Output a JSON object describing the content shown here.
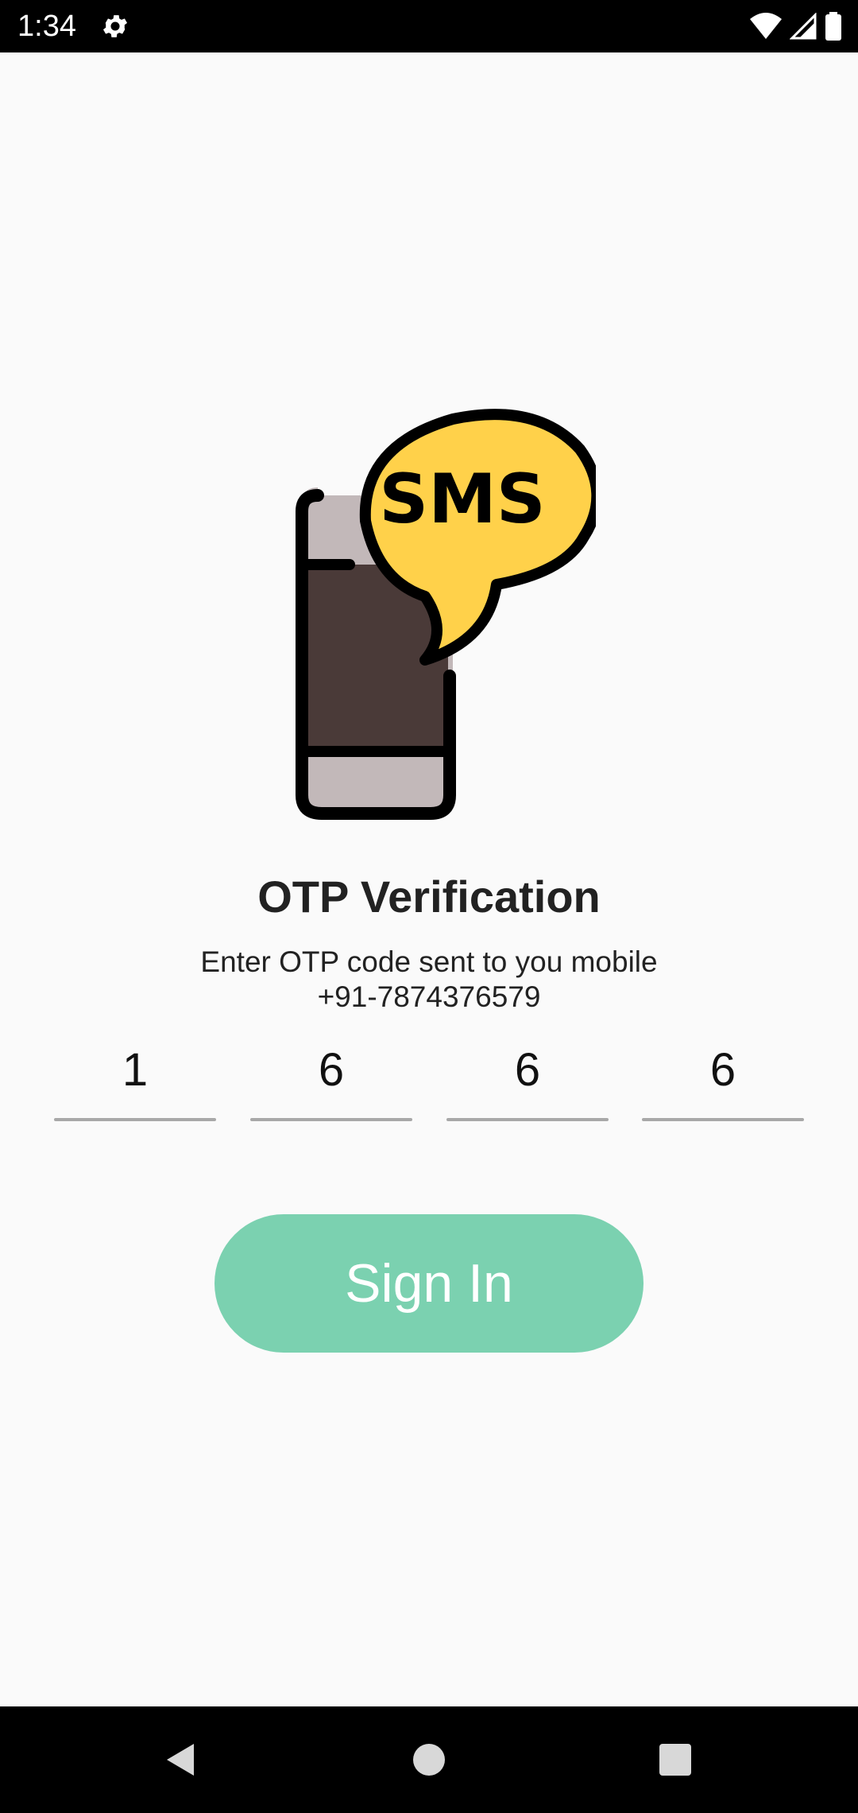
{
  "status_bar": {
    "time": "1:34",
    "icons": [
      "gear-icon",
      "wifi-icon",
      "signal-icon",
      "battery-icon"
    ]
  },
  "illustration": {
    "bubble_text": "SMS",
    "colors": {
      "bubble": "#ffd14a",
      "phone_body": "#c2b8b9",
      "phone_screen": "#4a3a38",
      "outline": "#000000"
    }
  },
  "screen": {
    "title": "OTP Verification",
    "subtitle": "Enter OTP code sent to you mobile",
    "phone": "+91-7874376579"
  },
  "otp": {
    "digits": [
      "1",
      "6",
      "6",
      "6"
    ]
  },
  "signin": {
    "label": "Sign In",
    "color": "#7bd1b0"
  },
  "nav_bar": {
    "icons": [
      "back-icon",
      "home-icon",
      "recents-icon"
    ]
  }
}
